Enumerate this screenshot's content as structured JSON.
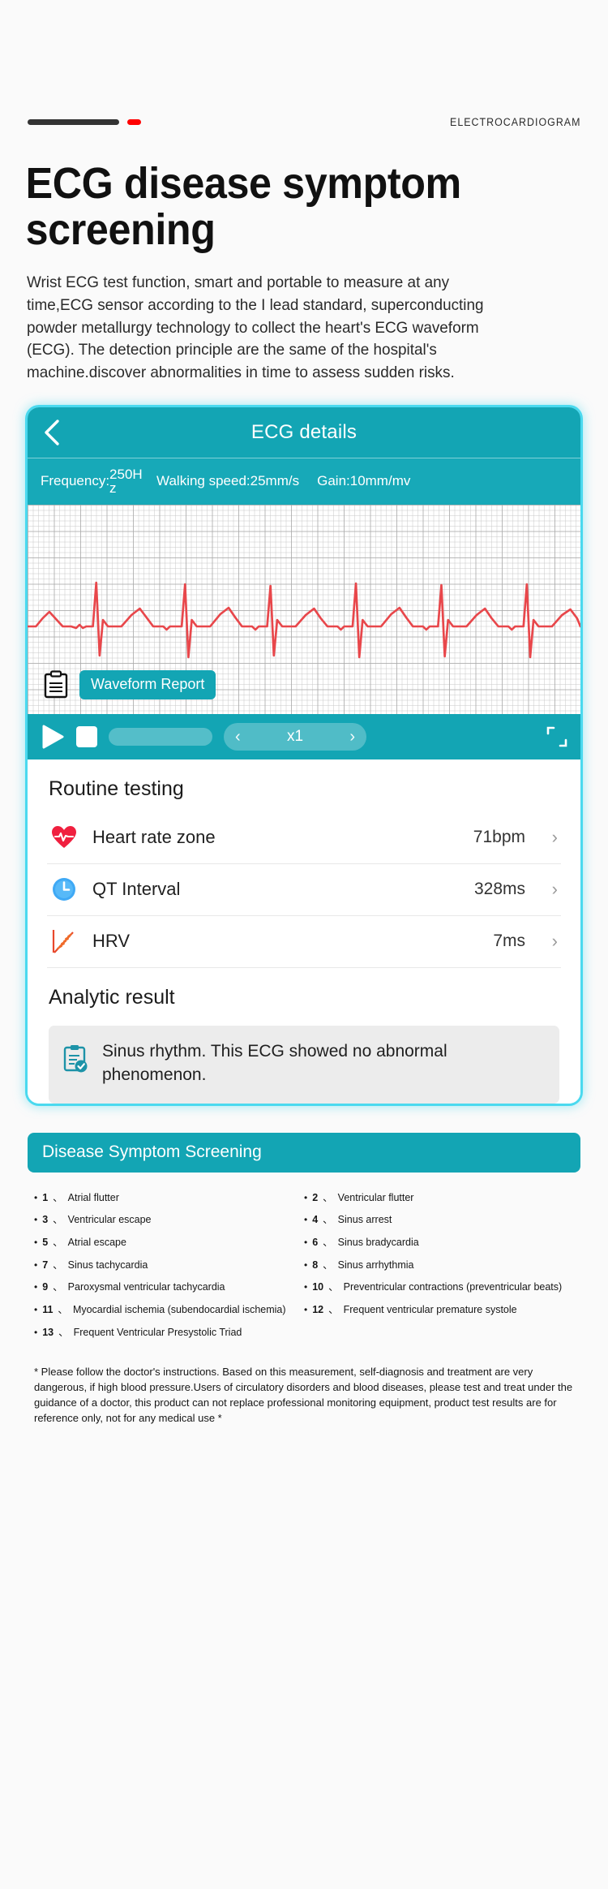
{
  "eyebrow": {
    "label": "ELECTROCARDIOGRAM"
  },
  "title": "ECG disease symptom screening",
  "intro": "Wrist ECG test function, smart and portable to measure at any time,ECG sensor according to the I lead standard, superconducting powder metallurgy technology to collect the heart's ECG waveform (ECG). The detection principle are the same of the hospital's machine.discover abnormalities in time to assess sudden risks.",
  "phone": {
    "header_title": "ECG details",
    "params": {
      "frequency_label": "Frequency:",
      "frequency_value": "250Hz",
      "walking_speed": "Walking speed:25mm/s",
      "gain": "Gain:10mm/mv"
    },
    "waveform_report_label": "Waveform Report",
    "controls": {
      "speed_value": "x1"
    },
    "routine": {
      "heading": "Routine testing",
      "rows": [
        {
          "icon": "heart-pulse-icon",
          "label": "Heart rate zone",
          "value": "71bpm"
        },
        {
          "icon": "clock-icon",
          "label": "QT Interval",
          "value": "328ms"
        },
        {
          "icon": "hrv-chart-icon",
          "label": "HRV",
          "value": "7ms"
        }
      ]
    },
    "analytic": {
      "heading": "Analytic result",
      "text": "Sinus rhythm. This ECG showed no abnormal phenomenon."
    }
  },
  "screening": {
    "pill_label": "Disease Symptom Screening",
    "items": [
      {
        "num": "1",
        "sep": "、",
        "text": "Atrial flutter"
      },
      {
        "num": "2",
        "sep": "、",
        "text": "Ventricular flutter"
      },
      {
        "num": "3",
        "sep": "、",
        "text": "Ventricular escape"
      },
      {
        "num": "4",
        "sep": "、",
        "text": "Sinus arrest"
      },
      {
        "num": "5",
        "sep": "、",
        "text": "Atrial escape"
      },
      {
        "num": "6",
        "sep": "、",
        "text": "Sinus bradycardia"
      },
      {
        "num": "7",
        "sep": "、",
        "text": "Sinus tachycardia"
      },
      {
        "num": "8",
        "sep": "、",
        "text": "Sinus arrhythmia"
      },
      {
        "num": "9",
        "sep": "、",
        "text": "Paroxysmal ventricular tachycardia"
      },
      {
        "num": "10",
        "sep": "、",
        "text": "Preventricular contractions (preventricular beats)"
      },
      {
        "num": "11",
        "sep": "、",
        "text": "Myocardial ischemia (subendocardial ischemia)"
      },
      {
        "num": "12",
        "sep": "、",
        "text": "Frequent ventricular premature systole"
      },
      {
        "num": "13",
        "sep": "、",
        "text": "Frequent Ventricular Presystolic Triad"
      }
    ],
    "disclaimer": "* Please follow the doctor's instructions. Based on this measurement, self-diagnosis and treatment are very dangerous, if high blood pressure.Users of circulatory disorders and blood diseases, please test and treat under the guidance of a doctor, this product can not replace professional monitoring equipment, product test results are for reference only, not for any medical use *"
  },
  "colors": {
    "teal": "#13a5b4",
    "glow": "#4ad9ef",
    "ecg_line": "#e8474b",
    "accent_red": "#ff0000"
  }
}
